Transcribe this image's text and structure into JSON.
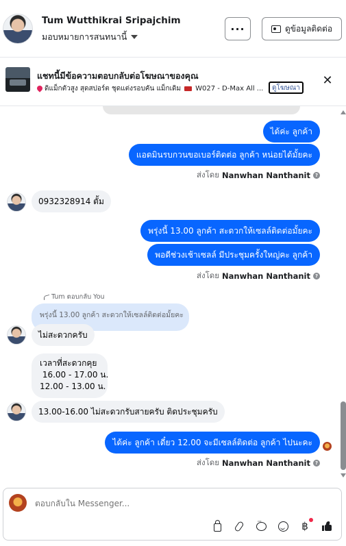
{
  "header": {
    "contact_name": "Tum Wutthikrai Sripajchim",
    "assign_label": "มอบหมายการสนทนานี้",
    "more_label": "···",
    "contact_info_label": "ดูข้อมูลติดต่อ"
  },
  "ad_banner": {
    "title": "แชทนี้มีข้อความตอบกลับต่อโฆษณาของคุณ",
    "subtitle": "ดิแม็กตัวสูง สุดสปอร์ต ชุดแต่งรอบคัน แม็กเดิม",
    "subtitle_tail": "W027 - D-Max All ...",
    "see_ad_label": "ดูโฆษณา",
    "close_label": "✕"
  },
  "messages": {
    "m1": "ได้ค่ะ  ลูกค้า",
    "m2": "แอดมินรบกวนขอเบอร์ติดต่อ ลูกค้า หน่อยได้มั้ยคะ",
    "sent_by_prefix": "ส่งโดย",
    "agent_name": "Nanwhan Nanthanit",
    "m3": "0932328914 ตั้ม",
    "m4": "พรุ่งนี้ 13.00 ลูกค้า สะดวกให้เซลล์ติดต่อมั้ยคะ",
    "m5": "พอดีช่วงเช้าเซลล์ มีประชุมครั้งใหญ่คะ  ลูกค้า",
    "reply_label": "Tum ตอบกลับ You",
    "quoted_text": "พรุ่งนี้ 13.00 ลูกค้า สะดวกให้เซลล์ติดต่อมั้ยคะ",
    "m6": "ไม่สะดวกครับ",
    "m7_line1": "เวลาที่สะดวกคุย",
    "m7_line2": " 16.00 - 17.00 น.",
    "m7_line3": "12.00 - 13.00 น.",
    "m8": "13.00-16.00 ไม่สะดวกรับสายครับ ติดประชุมครับ",
    "m9": "ได้ค่ะ  ลูกค้า เดี๋ยว 12.00 จะมีเซลล์ติดต่อ ลูกค้า ไปนะคะ"
  },
  "composer": {
    "placeholder": "ตอบกลับใน Messenger..."
  },
  "colors": {
    "outgoing_bubble": "#0866ff",
    "incoming_bubble": "#f0f2f5",
    "quoted_bubble": "#dbe8fb"
  }
}
